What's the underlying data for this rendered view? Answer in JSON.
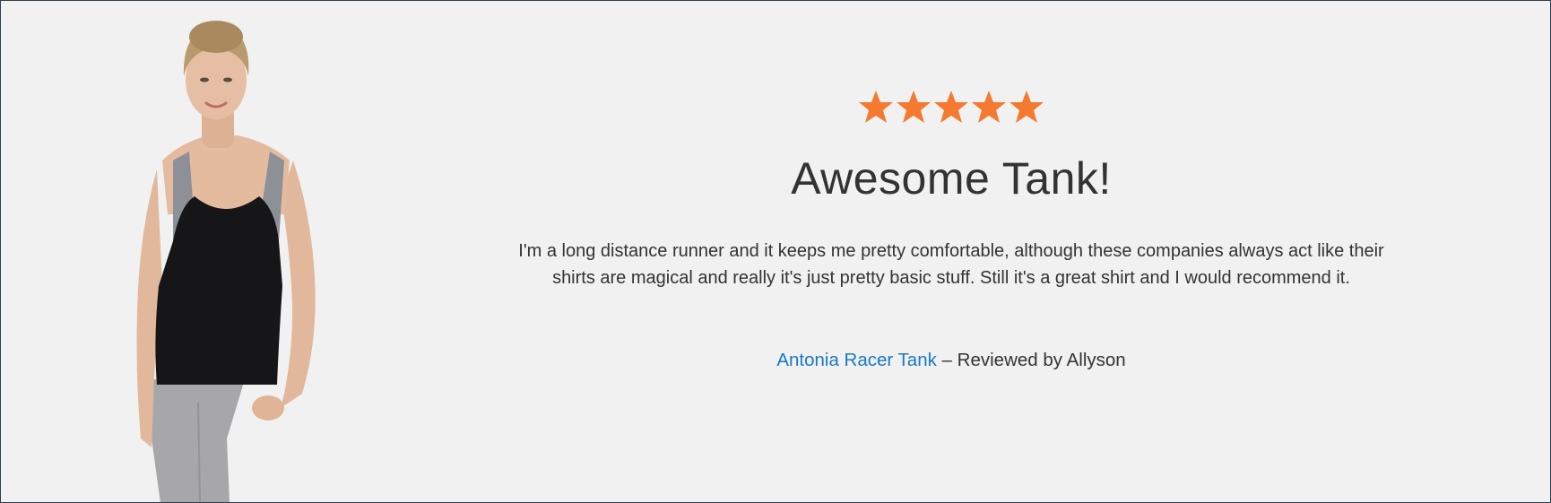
{
  "review": {
    "rating": {
      "value": 5,
      "max": 5,
      "star_glyph": "star-icon",
      "color": "#f47a30"
    },
    "title": "Awesome Tank!",
    "text": "I'm a long distance runner and it keeps me pretty comfortable, although these companies always act like their shirts are magical and really it's just pretty basic stuff. Still it's a great shirt and I would recommend it.",
    "product_name": "Antonia Racer Tank",
    "byline_separator": " – ",
    "byline_text": "Reviewed by Allyson"
  },
  "colors": {
    "background": "#f1f1f1",
    "text": "#333333",
    "link": "#1979c3",
    "border": "#2f3f4c"
  },
  "image": {
    "subject": "model-wearing-racer-tank-photo"
  }
}
